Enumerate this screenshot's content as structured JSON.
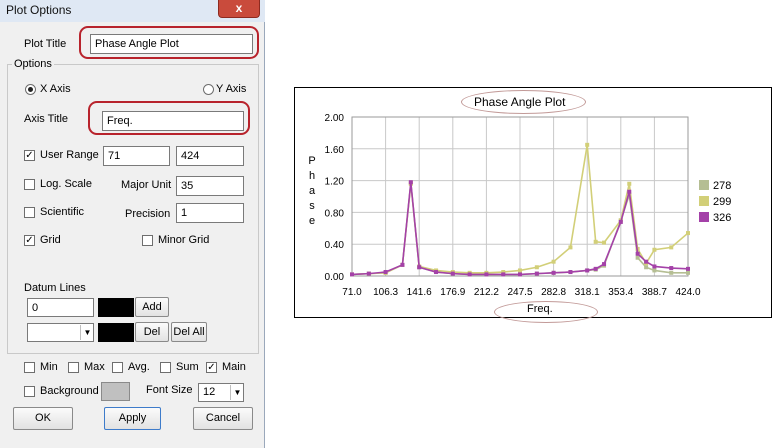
{
  "window": {
    "title": "Plot Options",
    "close_glyph": "x"
  },
  "plot_title": {
    "label": "Plot Title",
    "value": "Phase Angle Plot"
  },
  "options_group": {
    "label": "Options"
  },
  "axis_select": {
    "x_label": "X Axis",
    "y_label": "Y Axis",
    "selected": "X Axis"
  },
  "axis_title": {
    "label": "Axis Title",
    "value": "Freq."
  },
  "user_range": {
    "label": "User Range",
    "checked": true,
    "min": "71",
    "max": "424"
  },
  "log_scale": {
    "label": "Log. Scale",
    "checked": false
  },
  "major_unit": {
    "label": "Major Unit",
    "value": "35"
  },
  "scientific": {
    "label": "Scientific",
    "checked": false
  },
  "precision": {
    "label": "Precision",
    "value": "1"
  },
  "grid": {
    "label": "Grid",
    "checked": true
  },
  "minor_grid": {
    "label": "Minor Grid",
    "checked": false
  },
  "datum_lines": {
    "label": "Datum Lines",
    "value": "0",
    "color": "#000000",
    "add_label": "Add",
    "del_label": "Del",
    "del_all_label": "Del All"
  },
  "bottom_checks": [
    {
      "label": "Min",
      "checked": false
    },
    {
      "label": "Max",
      "checked": false
    },
    {
      "label": "Avg.",
      "checked": false
    },
    {
      "label": "Sum",
      "checked": false
    },
    {
      "label": "Main",
      "checked": true
    }
  ],
  "background": {
    "label": "Background",
    "checked": false,
    "color": "#c0c0c0"
  },
  "font_size": {
    "label": "Font Size",
    "value": "12"
  },
  "buttons": {
    "ok": "OK",
    "apply": "Apply",
    "cancel": "Cancel"
  },
  "check_glyph": "✓",
  "chart_data": {
    "type": "line",
    "title": "Phase Angle Plot",
    "xlabel": "Freq.",
    "ylabel": "Phase",
    "x_ticks": [
      "71.0",
      "106.3",
      "141.6",
      "176.9",
      "212.2",
      "247.5",
      "282.8",
      "318.1",
      "353.4",
      "388.7",
      "424.0"
    ],
    "y_ticks": [
      "0.00",
      "0.40",
      "0.80",
      "1.20",
      "1.60",
      "2.00"
    ],
    "xlim": [
      71,
      424
    ],
    "ylim": [
      0,
      2
    ],
    "grid": true,
    "legend_position": "right",
    "series": [
      {
        "name": "278",
        "color": "#b5be93",
        "x": [
          71,
          88.7,
          106.3,
          124,
          132.8,
          141.6,
          159.3,
          176.9,
          194.6,
          212.2,
          229.9,
          247.5,
          265.2,
          282.8,
          300.5,
          318.1,
          327,
          335.8,
          353.4,
          362.3,
          371.1,
          380,
          388.7,
          406.4,
          424
        ],
        "y": [
          0.02,
          0.03,
          0.04,
          0.14,
          1.17,
          0.11,
          0.05,
          0.03,
          0.02,
          0.02,
          0.02,
          0.02,
          0.03,
          0.04,
          0.05,
          0.07,
          0.08,
          0.13,
          0.7,
          1.02,
          0.23,
          0.11,
          0.07,
          0.04,
          0.04
        ]
      },
      {
        "name": "299",
        "color": "#d2cf78",
        "x": [
          71,
          88.7,
          106.3,
          124,
          132.8,
          141.6,
          159.3,
          176.9,
          194.6,
          212.2,
          229.9,
          247.5,
          265.2,
          282.8,
          300.5,
          318.1,
          327,
          335.8,
          353.4,
          362.3,
          371.1,
          380,
          388.7,
          406.4,
          424
        ],
        "y": [
          0.02,
          0.03,
          0.04,
          0.14,
          1.16,
          0.12,
          0.07,
          0.05,
          0.04,
          0.04,
          0.05,
          0.07,
          0.11,
          0.18,
          0.36,
          1.65,
          0.43,
          0.42,
          0.7,
          1.16,
          0.34,
          0.16,
          0.33,
          0.36,
          0.54
        ]
      },
      {
        "name": "326",
        "color": "#a441a8",
        "x": [
          71,
          88.7,
          106.3,
          124,
          132.8,
          141.6,
          159.3,
          176.9,
          194.6,
          212.2,
          229.9,
          247.5,
          265.2,
          282.8,
          300.5,
          318.1,
          327,
          335.8,
          353.4,
          362.3,
          371.1,
          380,
          388.7,
          406.4,
          424
        ],
        "y": [
          0.02,
          0.03,
          0.05,
          0.14,
          1.18,
          0.11,
          0.05,
          0.03,
          0.02,
          0.02,
          0.02,
          0.02,
          0.03,
          0.04,
          0.05,
          0.07,
          0.09,
          0.15,
          0.68,
          1.06,
          0.28,
          0.18,
          0.12,
          0.1,
          0.09
        ]
      }
    ]
  }
}
